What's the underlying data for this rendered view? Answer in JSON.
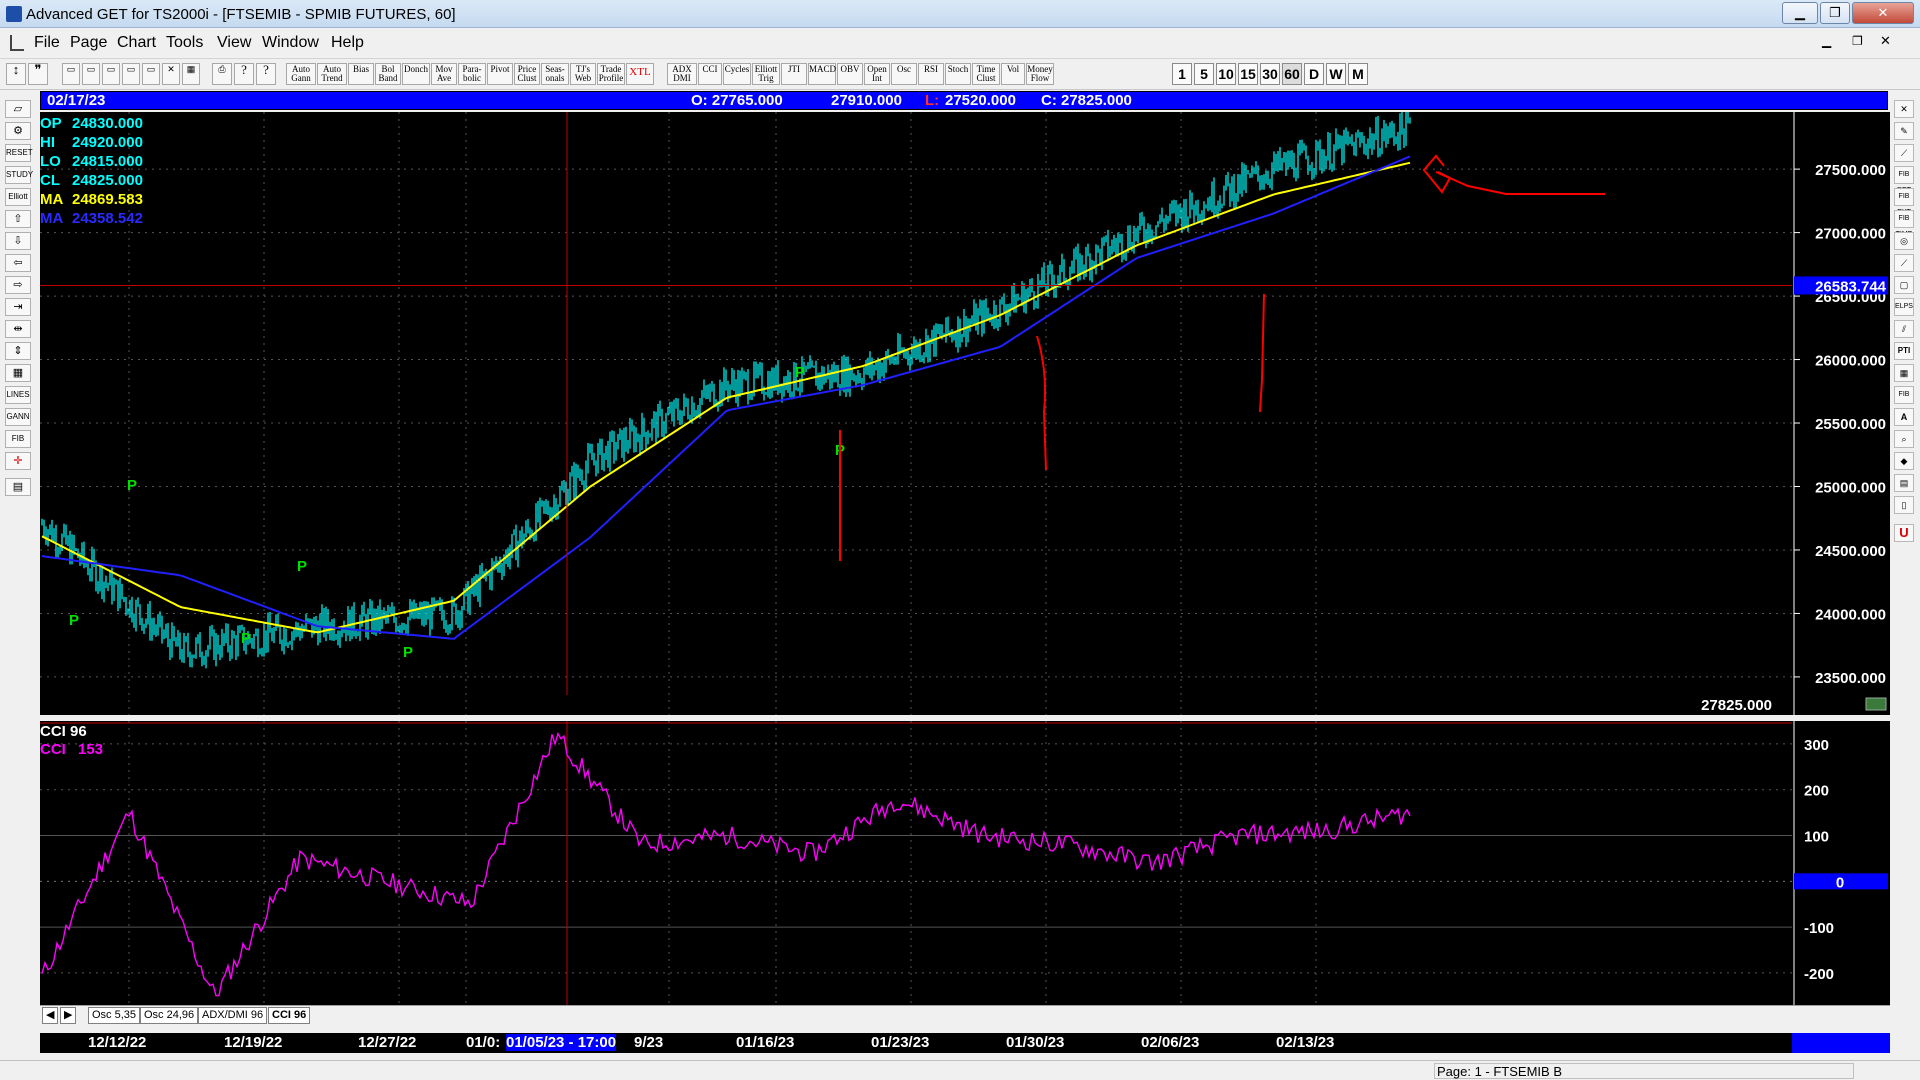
{
  "window": {
    "title": "Advanced GET for TS2000i - [FTSEMIB - SPMIB FUTURES, 60]",
    "minimize": "▁",
    "restore": "❐",
    "close": "✕"
  },
  "menu": [
    "File",
    "Page",
    "Chart",
    "Tools",
    "View",
    "Window",
    "Help"
  ],
  "toolbar": {
    "studies": [
      "Auto Gann",
      "Auto Trend",
      "Bias",
      "Bol Band",
      "Donch",
      "Mov Ave",
      "Para- bolic",
      "Pivot",
      "Price Clust",
      "Seas- onals",
      "TJ's Web",
      "Trade Profile",
      "XTL",
      "ADX DMI",
      "CCI",
      "Cycles",
      "Elliott Trig",
      "JTI",
      "MACD",
      "OBV",
      "Open Int",
      "Osc",
      "RSI",
      "Stoch",
      "Time Clust",
      "Vol",
      "Money Flow"
    ],
    "intervals": [
      "1",
      "5",
      "10",
      "15",
      "30",
      "60",
      "D",
      "W",
      "M"
    ]
  },
  "info": {
    "date": "02/17/23",
    "open": "O: 27765.000",
    "high": "27910.000",
    "low_label": "L:",
    "low": "27520.000",
    "close": "C: 27825.000"
  },
  "readout": [
    {
      "label": "OP",
      "value": "24830.000",
      "color": "#00ffff"
    },
    {
      "label": "HI",
      "value": "24920.000",
      "color": "#00ffff"
    },
    {
      "label": "LO",
      "value": "24815.000",
      "color": "#00ffff"
    },
    {
      "label": "CL",
      "value": "24825.000",
      "color": "#00ffff"
    },
    {
      "label": "MA",
      "value": "24869.583",
      "color": "#ffff00"
    },
    {
      "label": "MA",
      "value": "24358.542",
      "color": "#2a2aff"
    }
  ],
  "price_axis": [
    "27500.000",
    "27000.000",
    "26500.000",
    "26000.000",
    "25500.000",
    "25000.000",
    "24500.000",
    "24000.000",
    "23500.000"
  ],
  "cursor_price": "26583.744",
  "last_price": "27825.000",
  "oscillator": {
    "title": "CCI 96",
    "value_label": "CCI",
    "value": "153",
    "axis": [
      "300",
      "200",
      "100",
      "0",
      "-100",
      "-200"
    ]
  },
  "osc_tabs": [
    "Osc 5,35",
    "Osc 24,96",
    "ADX/DMI 96",
    "CCI 96"
  ],
  "dates": {
    "labels": [
      "12/12/22",
      "12/19/22",
      "12/27/22",
      "01/0:",
      "9/23",
      "01/16/23",
      "01/23/23",
      "01/30/23",
      "02/06/23",
      "02/13/23"
    ],
    "cursor": "01/05/23 - 17:00"
  },
  "pivot_mark": "P",
  "status": "Page: 1 - FTSEMIB B",
  "colors": {
    "bars": "#00ffff",
    "ma_fast": "#ffff00",
    "ma_slow": "#2020ff",
    "cci": "#ff00ff",
    "annotation": "#ff0000",
    "info_bg": "#0000ff"
  },
  "chart_data": {
    "type": "line",
    "x": [
      "12/12/22",
      "12/19/22",
      "12/27/22",
      "01/03/23",
      "01/09/23",
      "01/16/23",
      "01/23/23",
      "01/30/23",
      "02/06/23",
      "02/13/23",
      "02/17/23"
    ],
    "series": [
      {
        "values": [
          24700,
          23700,
          23900,
          24000,
          25200,
          25800,
          25900,
          26400,
          27000,
          27500,
          27825
        ]
      },
      {
        "name": "MA",
        "values": [
          24600,
          24050,
          23850,
          24100,
          25000,
          25700,
          25950,
          26350,
          26900,
          27300,
          27550
        ]
      },
      {
        "name": "MA",
        "values": [
          24450,
          24300,
          23900,
          23800,
          24600,
          25600,
          25800,
          26100,
          26800,
          27150,
          27600
        ]
      }
    ],
    "ylim": [
      23200,
      27950
    ],
    "cci": {
      "name": "CCI",
      "values": [
        -200,
        150,
        -250,
        50,
        0,
        -50,
        320,
        80,
        100,
        60,
        180,
        100,
        80,
        40,
        100,
        110,
        150
      ]
    },
    "cci_ylim": [
      -270,
      350
    ]
  }
}
